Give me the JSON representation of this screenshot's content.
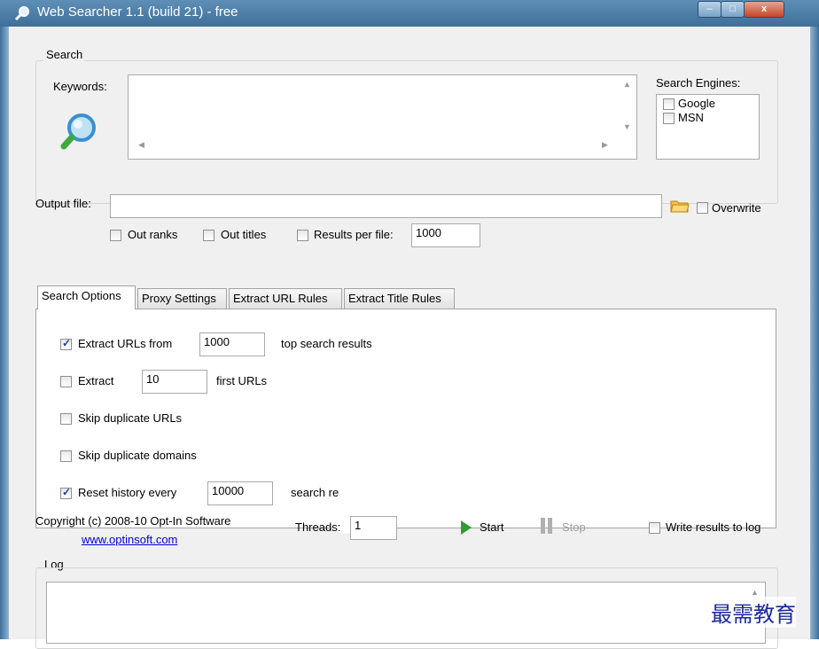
{
  "window": {
    "title": "Web Searcher 1.1 (build 21) - free",
    "close_glyph": "x",
    "max_glyph": "□",
    "min_glyph": "–"
  },
  "search": {
    "group_label": "Search",
    "keywords_label": "Keywords:",
    "keywords_value": "",
    "engines_label": "Search Engines:",
    "engines": [
      {
        "label": "Google",
        "checked": false
      },
      {
        "label": "MSN",
        "checked": false
      }
    ]
  },
  "output": {
    "label": "Output file:",
    "value": "",
    "overwrite_label": "Overwrite",
    "out_ranks_label": "Out ranks",
    "out_titles_label": "Out titles",
    "results_per_file_label": "Results per file:",
    "results_per_file_value": "1000"
  },
  "tabs": [
    "Search Options",
    "Proxy Settings",
    "Extract URL Rules",
    "Extract Title Rules"
  ],
  "options": {
    "extract_urls_label": "Extract URLs from",
    "extract_urls_value": "1000",
    "extract_urls_suffix": "top search results",
    "extract_label": "Extract",
    "extract_value": "10",
    "extract_suffix": "first URLs",
    "skip_dup_urls_label": "Skip duplicate URLs",
    "skip_dup_domains_label": "Skip duplicate domains",
    "reset_history_label": "Reset history every",
    "reset_history_value": "10000",
    "reset_history_suffix": "search re"
  },
  "footer": {
    "copyright": "Copyright (c) 2008-10 Opt-In Software",
    "website": "www.optinsoft.com",
    "threads_label": "Threads:",
    "threads_value": "1",
    "start_label": "Start",
    "stop_label": "Stop",
    "write_log_label": "Write results to log"
  },
  "log": {
    "label": "Log"
  },
  "watermark": "最需教育",
  "colors": {
    "accent": "#1c3f8a",
    "link": "#0000cc",
    "start_green": "#2e9e2e"
  }
}
